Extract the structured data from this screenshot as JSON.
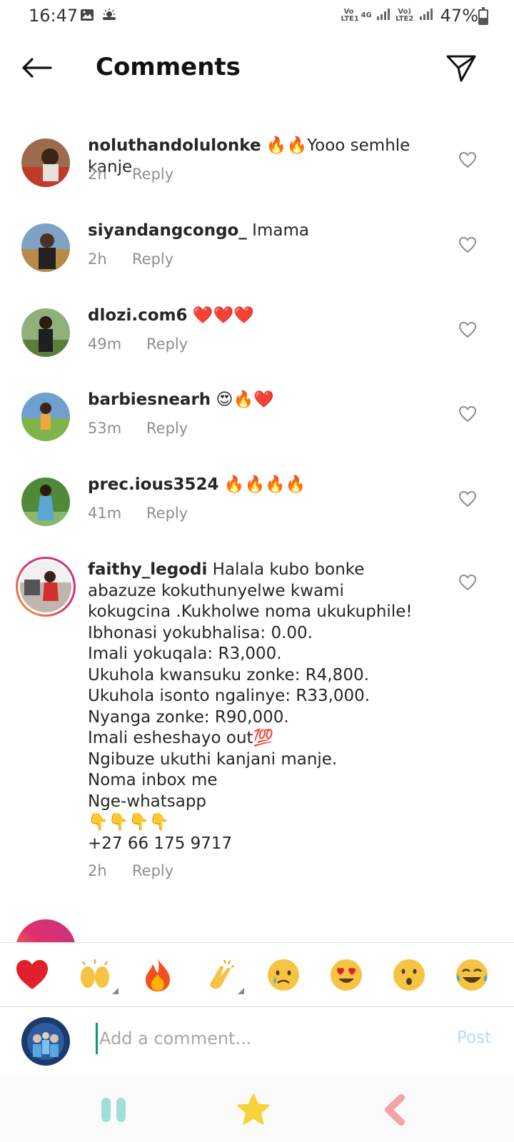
{
  "status_bar": {
    "time": "16:47",
    "network_1": "Vo LTE1",
    "network_type": "4G",
    "network_2": "Vo) LTE2",
    "battery": "47%"
  },
  "header": {
    "title": "Comments"
  },
  "comments": [
    {
      "username": "noluthandolulonke",
      "text": " 🔥🔥Yooo semhle kanje",
      "time": "2h",
      "reply": "Reply"
    },
    {
      "username": "siyandangcongo_",
      "text": " Imama",
      "time": "2h",
      "reply": "Reply"
    },
    {
      "username": "dlozi.com6",
      "text": " ❤️❤️❤️",
      "time": "49m",
      "reply": "Reply"
    },
    {
      "username": "barbiesnearh",
      "text": " 😍🔥❤️",
      "time": "53m",
      "reply": "Reply"
    },
    {
      "username": "prec.ious3524",
      "text": " 🔥🔥🔥🔥",
      "time": "41m",
      "reply": "Reply"
    },
    {
      "username": "faithy_legodi",
      "first_line": " Halala kubo bonke",
      "lines": [
        "abazuze kokuthunyelwe kwami",
        "kokugcina .Kukholwe noma ukukuphile!",
        "Ibhonasi yokubhalisa: 0.00.",
        "Imali yokuqala: R3,000.",
        "Ukuhola kwansuku zonke: R4,800.",
        "Ukuhola isonto ngalinye: R33,000.",
        "Nyanga zonke: R90,000.",
        "Imali esheshayo out💯",
        "Ngibuze ukuthi kanjani manje.",
        "Noma inbox me",
        "Nge-whatsapp",
        " 👇👇👇👇",
        "+27 66 175 9717"
      ],
      "time": "2h",
      "reply": "Reply"
    }
  ],
  "emoji_bar": [
    "❤️",
    "🙌",
    "🔥",
    "👏",
    "😢",
    "😍",
    "😮",
    "😂"
  ],
  "input": {
    "placeholder": "Add a comment...",
    "post_label": "Post"
  },
  "colors": {
    "accent_post_disabled": "#b3dbff",
    "nav_pause": "#9fe0d6",
    "nav_star": "#f7d33b",
    "nav_back": "#f4a3a8"
  }
}
